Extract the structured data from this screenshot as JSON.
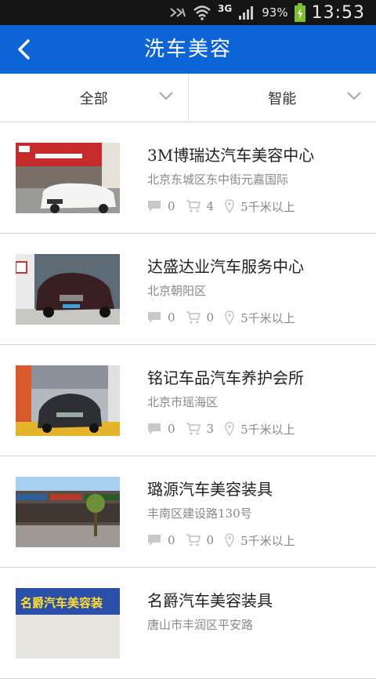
{
  "status_bar": {
    "network": "3G",
    "battery": "93%",
    "time": "13:53"
  },
  "header": {
    "title": "洗车美容",
    "back_icon": "chevron-left-icon"
  },
  "filters": [
    {
      "label": "全部",
      "icon": "chevron-down-icon"
    },
    {
      "label": "智能",
      "icon": "chevron-down-icon"
    }
  ],
  "shops": [
    {
      "name": "3M博瑞达汽车美容中心",
      "address": "北京东城区东中街元嘉国际",
      "comments": "0",
      "orders": "4",
      "distance": "5千米以上"
    },
    {
      "name": "达盛达业汽车服务中心",
      "address": "北京朝阳区",
      "comments": "0",
      "orders": "0",
      "distance": "5千米以上"
    },
    {
      "name": "铭记车品汽车养护会所",
      "address": "北京市瑶海区",
      "comments": "0",
      "orders": "3",
      "distance": "5千米以上"
    },
    {
      "name": "璐源汽车美容装具",
      "address": "丰南区建设路130号",
      "comments": "0",
      "orders": "0",
      "distance": "5千米以上"
    },
    {
      "name": "名爵汽车美容装具",
      "address": "唐山市丰润区平安路",
      "comments": "",
      "orders": "",
      "distance": ""
    }
  ],
  "thumb_sign_text": "名爵汽车美容装",
  "colors": {
    "accent": "#0d64d6",
    "statusbar": "#151515",
    "battery": "#7cc22e"
  }
}
